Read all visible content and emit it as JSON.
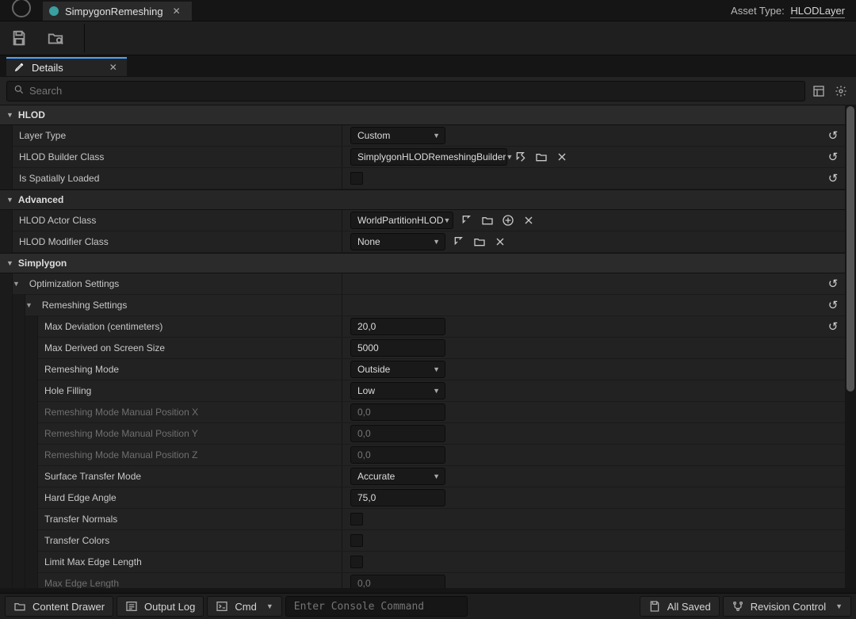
{
  "titlebar": {
    "asset_tab": "SimpygonRemeshing",
    "asset_type_label": "Asset Type:",
    "asset_type_value": "HLODLayer"
  },
  "details_tab": "Details",
  "search_placeholder": "Search",
  "categories": {
    "hlod": {
      "title": "HLOD",
      "layer_type": {
        "label": "Layer Type",
        "value": "Custom"
      },
      "builder_class": {
        "label": "HLOD Builder Class",
        "value": "SimplygonHLODRemeshingBuilder"
      },
      "spatially_loaded": {
        "label": "Is Spatially Loaded"
      }
    },
    "advanced": {
      "title": "Advanced",
      "actor_class": {
        "label": "HLOD Actor Class",
        "value": "WorldPartitionHLOD"
      },
      "modifier_class": {
        "label": "HLOD Modifier Class",
        "value": "None"
      }
    },
    "simplygon": {
      "title": "Simplygon",
      "opt": {
        "title": "Optimization Settings"
      },
      "remesh": {
        "title": "Remeshing Settings"
      },
      "max_deviation": {
        "label": "Max Deviation (centimeters)",
        "value": "20,0"
      },
      "max_derived": {
        "label": "Max Derived on Screen Size",
        "value": "5000"
      },
      "remesh_mode": {
        "label": "Remeshing Mode",
        "value": "Outside"
      },
      "hole_filling": {
        "label": "Hole Filling",
        "value": "Low"
      },
      "manual_x": {
        "label": "Remeshing Mode Manual Position X",
        "value": "0,0"
      },
      "manual_y": {
        "label": "Remeshing Mode Manual Position Y",
        "value": "0,0"
      },
      "manual_z": {
        "label": "Remeshing Mode Manual Position Z",
        "value": "0,0"
      },
      "surface_transfer": {
        "label": "Surface Transfer Mode",
        "value": "Accurate"
      },
      "hard_edge": {
        "label": "Hard Edge Angle",
        "value": "75,0"
      },
      "transfer_normals": {
        "label": "Transfer Normals"
      },
      "transfer_colors": {
        "label": "Transfer Colors"
      },
      "limit_max_edge": {
        "label": "Limit Max Edge Length"
      },
      "max_edge": {
        "label": "Max Edge Length",
        "value": "0,0"
      }
    }
  },
  "statusbar": {
    "content_drawer": "Content Drawer",
    "output_log": "Output Log",
    "cmd": "Cmd",
    "console_placeholder": "Enter Console Command",
    "all_saved": "All Saved",
    "revision": "Revision Control"
  }
}
